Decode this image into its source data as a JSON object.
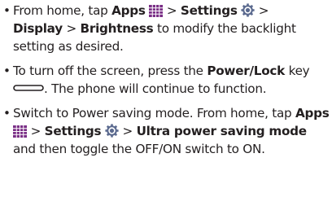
{
  "tips": [
    {
      "bullet": "•",
      "t1": "From home, tap ",
      "apps": "Apps",
      "sep1": " > ",
      "settings": "Settings",
      "sep2": " > ",
      "display": "Display",
      "sep3": " > ",
      "brightness": "Brightness",
      "tail": " to modify the backlight setting as desired."
    },
    {
      "bullet": "•",
      "t1": "To turn off the screen, press the ",
      "key": "Power/Lock",
      "t2": " key ",
      "tail": ". The phone will continue to function."
    },
    {
      "bullet": "•",
      "t1": "Switch to Power saving mode. From home, tap ",
      "apps": "Apps",
      "sep1": " > ",
      "settings": "Settings",
      "sep2": " > ",
      "ultra": "Ultra power saving mode",
      "tail": " and then toggle the OFF/ON switch to ON."
    }
  ],
  "icons": {
    "apps": "apps-grid-icon",
    "settings": "settings-gear-icon",
    "power_key": "power-lock-key-icon"
  },
  "colors": {
    "text": "#231f20",
    "apps_icon": "#7a2f86",
    "settings_icon": "#5b6a8f"
  }
}
